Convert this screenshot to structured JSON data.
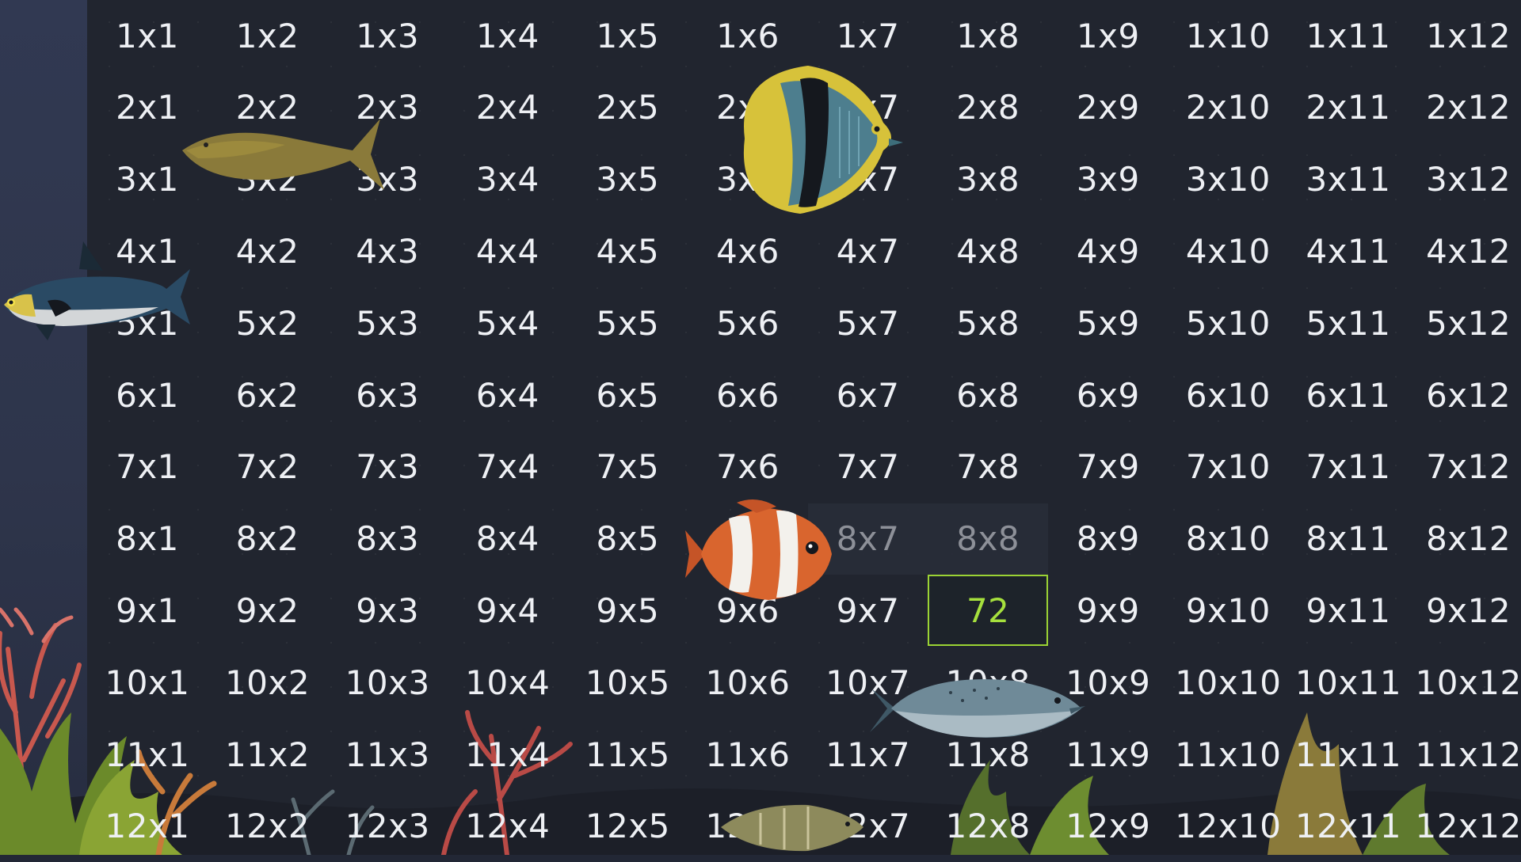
{
  "game": {
    "type": "multiplication-table",
    "rows": 12,
    "cols": 12,
    "answered": [
      {
        "row": 9,
        "col": 8,
        "answer": "72"
      }
    ],
    "dimmed": [
      {
        "row": 8,
        "col": 7
      },
      {
        "row": 8,
        "col": 8
      }
    ],
    "colors": {
      "background": "#21252f",
      "side_panel": "#313952",
      "cell_text": "#eef0f4",
      "dim_text": "#8d9098",
      "selected_border": "#9bd334",
      "selected_text": "#a6e03d"
    }
  },
  "decorations": [
    "yellow-fish",
    "angelfish",
    "sardine",
    "clownfish",
    "salmon",
    "striped-fish",
    "coral-reef",
    "seaweed"
  ]
}
